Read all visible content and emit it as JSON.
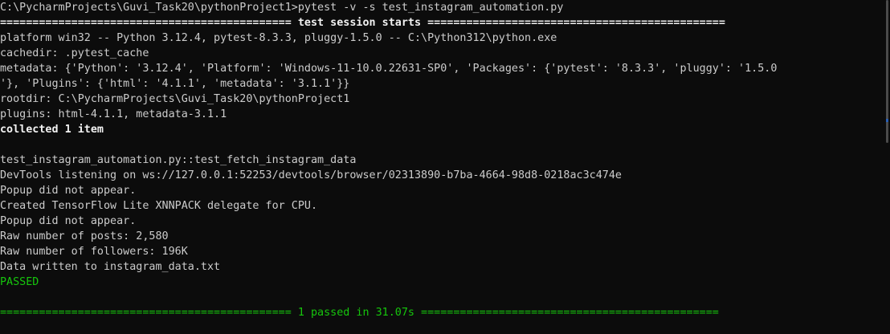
{
  "terminal": {
    "lines": [
      {
        "text": "C:\\PycharmProjects\\Guvi_Task20\\pythonProject1>pytest -v -s test_instagram_automation.py",
        "style": "normal"
      },
      {
        "text": "============================================= test session starts ==============================================",
        "style": "bold"
      },
      {
        "text": "platform win32 -- Python 3.12.4, pytest-8.3.3, pluggy-1.5.0 -- C:\\Python312\\python.exe",
        "style": "normal"
      },
      {
        "text": "cachedir: .pytest_cache",
        "style": "normal"
      },
      {
        "text": "metadata: {'Python': '3.12.4', 'Platform': 'Windows-11-10.0.22631-SP0', 'Packages': {'pytest': '8.3.3', 'pluggy': '1.5.0",
        "style": "normal"
      },
      {
        "text": "'}, 'Plugins': {'html': '4.1.1', 'metadata': '3.1.1'}}",
        "style": "normal"
      },
      {
        "text": "rootdir: C:\\PycharmProjects\\Guvi_Task20\\pythonProject1",
        "style": "normal"
      },
      {
        "text": "plugins: html-4.1.1, metadata-3.1.1",
        "style": "normal"
      },
      {
        "text": "collected 1 item",
        "style": "bold"
      },
      {
        "text": "",
        "style": "normal"
      },
      {
        "text": "test_instagram_automation.py::test_fetch_instagram_data",
        "style": "normal"
      },
      {
        "text": "DevTools listening on ws://127.0.0.1:52253/devtools/browser/02313890-b7ba-4664-98d8-0218ac3c474e",
        "style": "normal"
      },
      {
        "text": "Popup did not appear.",
        "style": "normal"
      },
      {
        "text": "Created TensorFlow Lite XNNPACK delegate for CPU.",
        "style": "normal"
      },
      {
        "text": "Popup did not appear.",
        "style": "normal"
      },
      {
        "text": "Raw number of posts: 2,580",
        "style": "normal"
      },
      {
        "text": "Raw number of followers: 196K",
        "style": "normal"
      },
      {
        "text": "Data written to instagram_data.txt",
        "style": "normal"
      },
      {
        "text": "PASSED",
        "style": "green"
      },
      {
        "text": "",
        "style": "normal"
      },
      {
        "text": "============================================= 1 passed in 31.07s ==============================================",
        "style": "green"
      }
    ]
  },
  "colors": {
    "background": "#0c0c0c",
    "foreground": "#cccccc",
    "bold": "#f2f2f2",
    "green": "#16c60c"
  }
}
